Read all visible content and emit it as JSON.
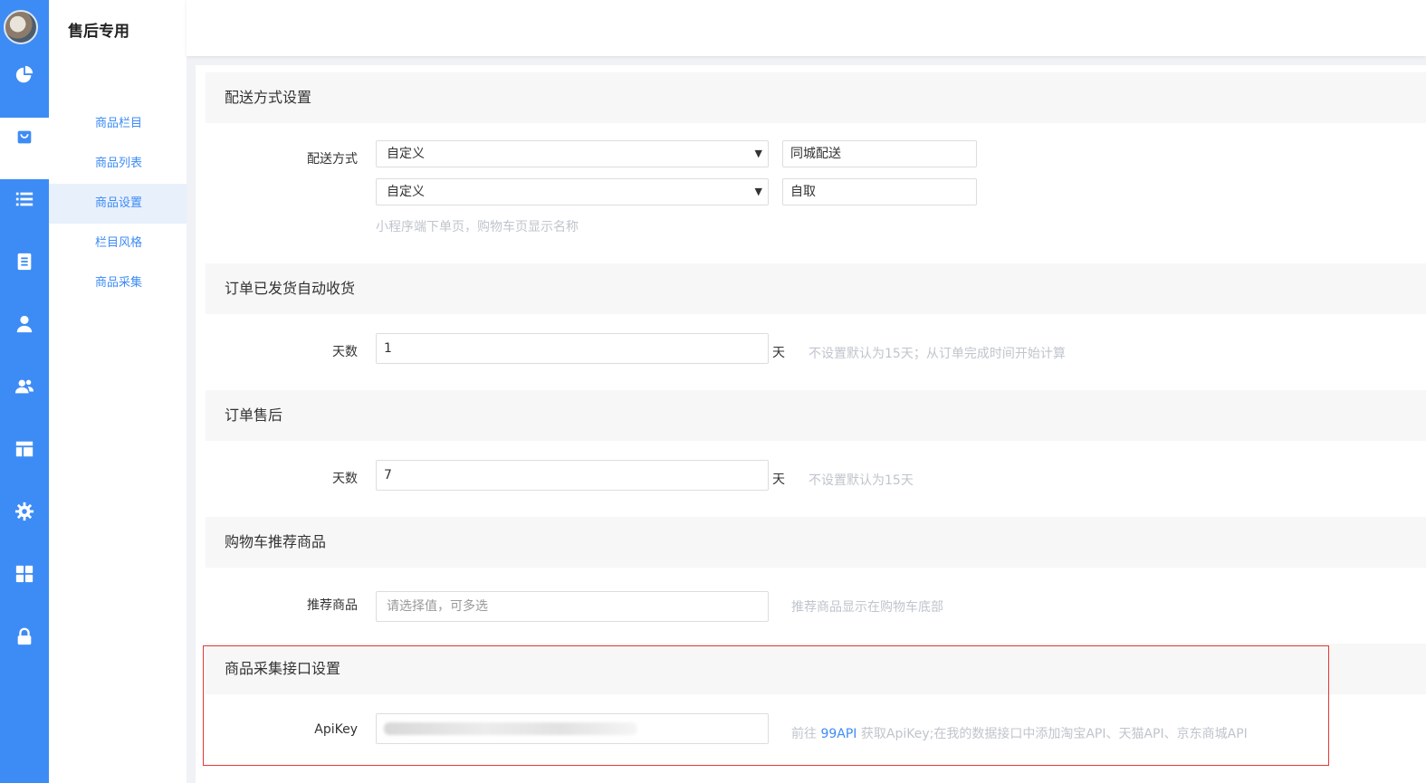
{
  "app": {
    "title": "售后专用"
  },
  "rail": {
    "items": [
      {
        "label": "总览",
        "icon": "pie-chart-icon"
      },
      {
        "label": "商品",
        "icon": "shopping-bag-icon"
      },
      {
        "label": "内容",
        "icon": "list-icon"
      },
      {
        "label": "订单",
        "icon": "document-icon"
      },
      {
        "label": "用户",
        "icon": "user-icon"
      },
      {
        "label": "分销",
        "icon": "users-icon"
      },
      {
        "label": "DIY",
        "icon": "layout-icon"
      },
      {
        "label": "系统",
        "icon": "gear-icon"
      },
      {
        "label": "应用",
        "icon": "grid-icon"
      },
      {
        "label": "权限",
        "icon": "lock-icon"
      }
    ],
    "active": "商品"
  },
  "submenu": {
    "items": [
      {
        "label": "商品栏目"
      },
      {
        "label": "商品列表"
      },
      {
        "label": "商品设置"
      },
      {
        "label": "栏目风格"
      },
      {
        "label": "商品采集"
      }
    ],
    "active": "商品设置"
  },
  "sections": {
    "delivery": {
      "title": "配送方式设置",
      "label": "配送方式",
      "rows": [
        {
          "select": "自定义",
          "name": "同城配送"
        },
        {
          "select": "自定义",
          "name": "自取"
        }
      ],
      "hint": "小程序端下单页，购物车页显示名称"
    },
    "auto_receive": {
      "title": "订单已发货自动收货",
      "label": "天数",
      "value": "1",
      "unit": "天",
      "hint": "不设置默认为15天；从订单完成时间开始计算"
    },
    "after_sale": {
      "title": "订单售后",
      "label": "天数",
      "value": "7",
      "unit": "天",
      "hint": "不设置默认为15天"
    },
    "cart_recommend": {
      "title": "购物车推荐商品",
      "label": "推荐商品",
      "placeholder": "请选择值，可多选",
      "hint": "推荐商品显示在购物车底部"
    },
    "collect_api": {
      "title": "商品采集接口设置",
      "label": "ApiKey",
      "hint_prefix": "前往 ",
      "hint_link": "99API",
      "hint_suffix": " 获取ApiKey;在我的数据接口中添加淘宝API、天猫API、京东商城API"
    }
  },
  "colors": {
    "accent": "#3d8cf5",
    "highlight_border": "#e53935",
    "hint": "#c0c4cc"
  }
}
